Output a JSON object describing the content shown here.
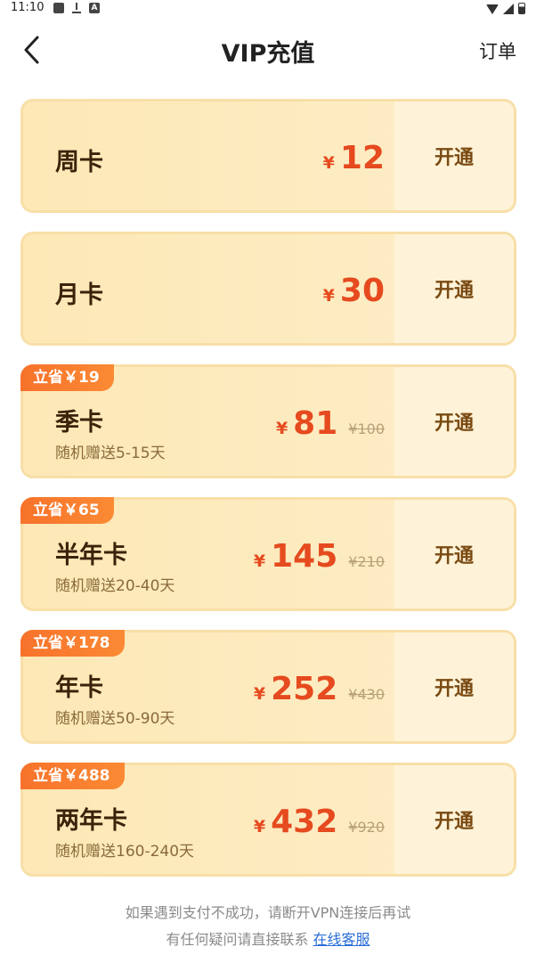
{
  "status_bar": {
    "time": "11:10",
    "a_icon": "A"
  },
  "nav": {
    "title": "VIP充值",
    "orders_label": "订单"
  },
  "currency": "¥",
  "cards": [
    {
      "name": "周卡",
      "price": "12",
      "button": "开通"
    },
    {
      "name": "月卡",
      "price": "30",
      "button": "开通"
    },
    {
      "name": "季卡",
      "price": "81",
      "original": "¥100",
      "badge": "立省￥19",
      "sub": "随机赠送5-15天",
      "button": "开通"
    },
    {
      "name": "半年卡",
      "price": "145",
      "original": "¥210",
      "badge": "立省￥65",
      "sub": "随机赠送20-40天",
      "button": "开通"
    },
    {
      "name": "年卡",
      "price": "252",
      "original": "¥430",
      "badge": "立省￥178",
      "sub": "随机赠送50-90天",
      "button": "开通"
    },
    {
      "name": "两年卡",
      "price": "432",
      "original": "¥920",
      "badge": "立省￥488",
      "sub": "随机赠送160-240天",
      "button": "开通"
    }
  ],
  "footer": {
    "line1": "如果遇到支付不成功，请断开VPN连接后再试",
    "line2_prefix": "有任何疑问请直接联系 ",
    "support_link": "在线客服"
  },
  "colors": {
    "accent": "#e64a1f",
    "badge": "#f7722b",
    "link": "#2a6ed8"
  },
  "icons": [
    "image-icon",
    "download-icon",
    "a-icon",
    "wifi-icon",
    "signal-icon",
    "battery-icon",
    "back-arrow-icon"
  ]
}
